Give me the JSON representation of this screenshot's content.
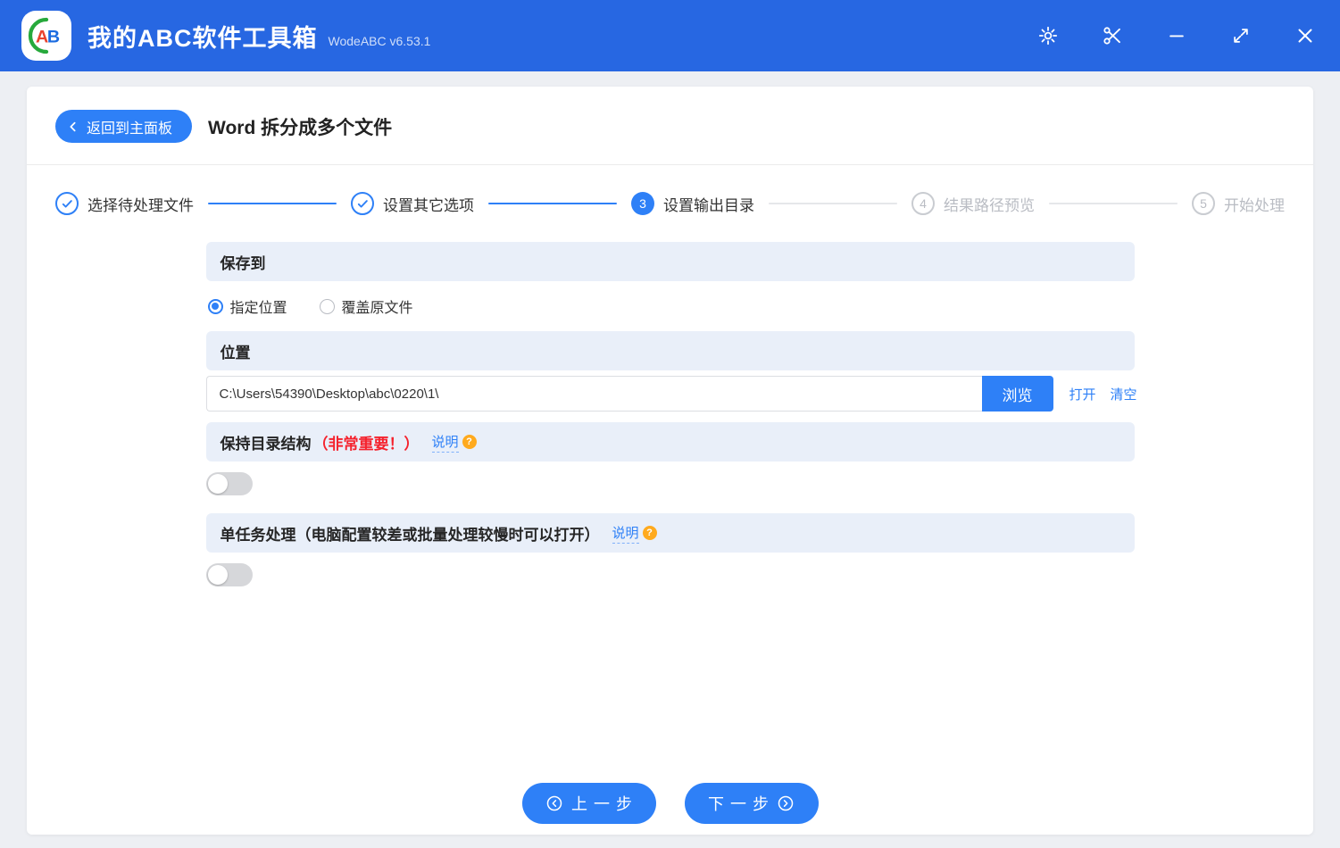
{
  "app": {
    "logo_text": "AB",
    "title": "我的ABC软件工具箱",
    "version": "WodeABC v6.53.1"
  },
  "titlebar_icons": [
    "settings",
    "scissors",
    "minimize",
    "fullscreen",
    "close"
  ],
  "header": {
    "back_label": "返回到主面板",
    "page_title": "Word 拆分成多个文件"
  },
  "steps": [
    {
      "label": "选择待处理文件",
      "state": "done"
    },
    {
      "label": "设置其它选项",
      "state": "done"
    },
    {
      "number": "3",
      "label": "设置输出目录",
      "state": "active"
    },
    {
      "number": "4",
      "label": "结果路径预览",
      "state": "pending"
    },
    {
      "number": "5",
      "label": "开始处理",
      "state": "pending"
    }
  ],
  "save_to": {
    "title": "保存到",
    "option_specified": "指定位置",
    "option_overwrite": "覆盖原文件",
    "selected": "指定位置"
  },
  "location": {
    "title": "位置",
    "path": "C:\\Users\\54390\\Desktop\\abc\\0220\\1\\",
    "browse": "浏览",
    "open": "打开",
    "clear": "清空"
  },
  "keep_structure": {
    "title": "保持目录结构",
    "warning": "（非常重要！）",
    "help": "说明",
    "help_badge": "?",
    "enabled": false
  },
  "single_task": {
    "title": "单任务处理（电脑配置较差或批量处理较慢时可以打开）",
    "help": "说明",
    "help_badge": "?",
    "enabled": false
  },
  "footer": {
    "prev": "上一步",
    "next": "下一步"
  },
  "colors": {
    "titlebar_blue": "#2767e2",
    "primary_blue": "#2e80f7",
    "section_bar_bg": "#e9eff9",
    "warning_red": "#f5222d",
    "help_orange": "#ffaa1e",
    "logo_green": "#27a93c",
    "logo_red": "#e8432e"
  }
}
